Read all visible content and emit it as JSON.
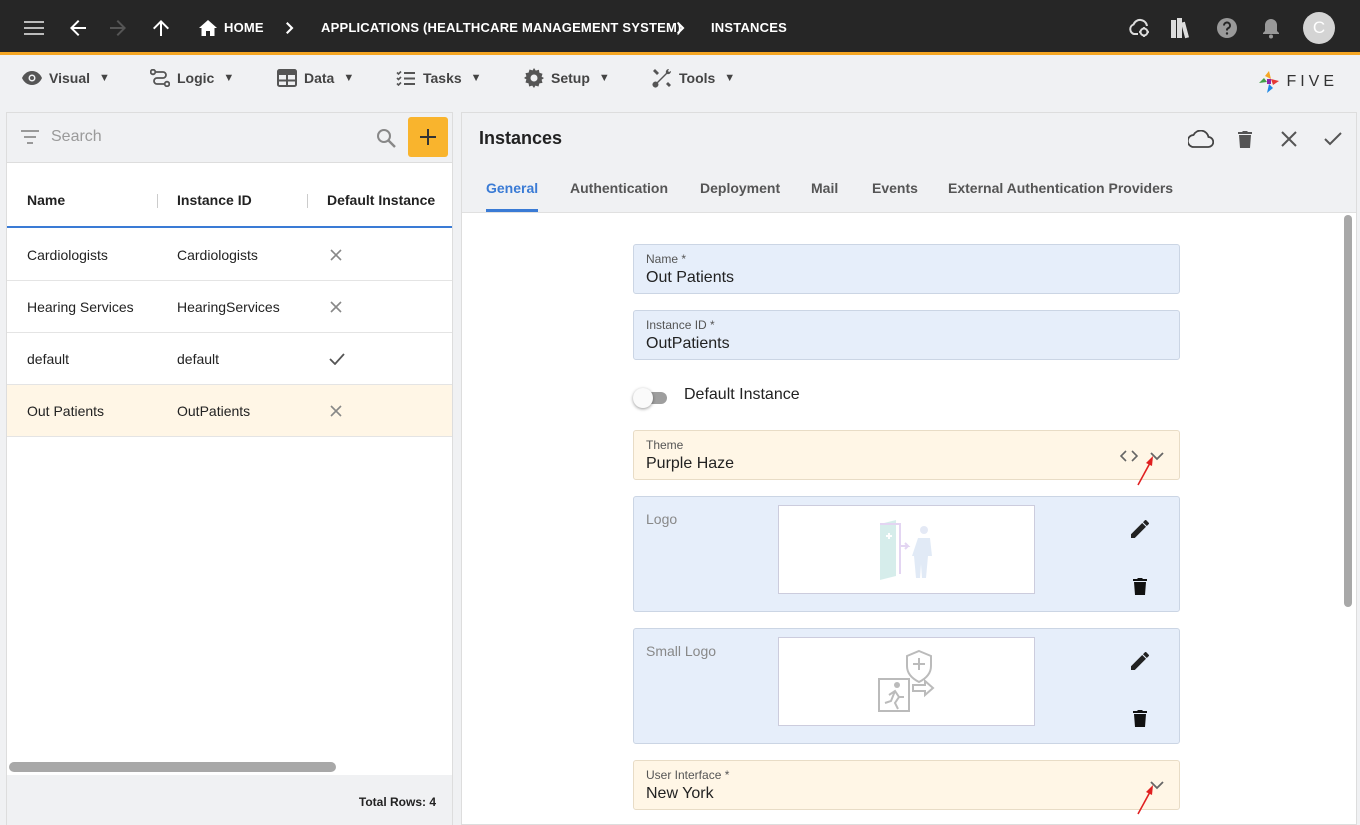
{
  "breadcrumb": {
    "home": "HOME",
    "app": "APPLICATIONS (HEALTHCARE MANAGEMENT SYSTEM)",
    "current": "INSTANCES"
  },
  "user": {
    "avatar_letter": "C"
  },
  "menu": [
    {
      "label": "Visual",
      "icon": "eye-icon"
    },
    {
      "label": "Logic",
      "icon": "logic-icon"
    },
    {
      "label": "Data",
      "icon": "table-icon"
    },
    {
      "label": "Tasks",
      "icon": "tasks-icon"
    },
    {
      "label": "Setup",
      "icon": "gear-icon"
    },
    {
      "label": "Tools",
      "icon": "tools-icon"
    }
  ],
  "brand": {
    "name": "FIVE"
  },
  "list": {
    "search_placeholder": "Search",
    "columns": [
      "Name",
      "Instance ID",
      "Default Instance"
    ],
    "rows": [
      {
        "name": "Cardiologists",
        "id": "Cardiologists",
        "default": false
      },
      {
        "name": "Hearing Services",
        "id": "HearingServices",
        "default": false
      },
      {
        "name": "default",
        "id": "default",
        "default": true
      },
      {
        "name": "Out Patients",
        "id": "OutPatients",
        "default": false
      }
    ],
    "total_rows": "Total Rows: 4"
  },
  "form": {
    "title": "Instances",
    "tabs": [
      "General",
      "Authentication",
      "Deployment",
      "Mail",
      "Events",
      "External Authentication Providers"
    ],
    "name_label": "Name *",
    "name_value": "Out Patients",
    "instance_id_label": "Instance ID *",
    "instance_id_value": "OutPatients",
    "default_instance_label": "Default Instance",
    "default_instance_value": false,
    "theme_label": "Theme",
    "theme_value": "Purple Haze",
    "logo_label": "Logo",
    "small_logo_label": "Small Logo",
    "ui_label": "User Interface *",
    "ui_value": "New York"
  },
  "colors": {
    "accent": "#f9b42d",
    "tab_active": "#3a7bd5",
    "field_bg": "#e6eefa",
    "field_orange_bg": "#fff6e6",
    "annotation_arrow": "#e02020"
  }
}
